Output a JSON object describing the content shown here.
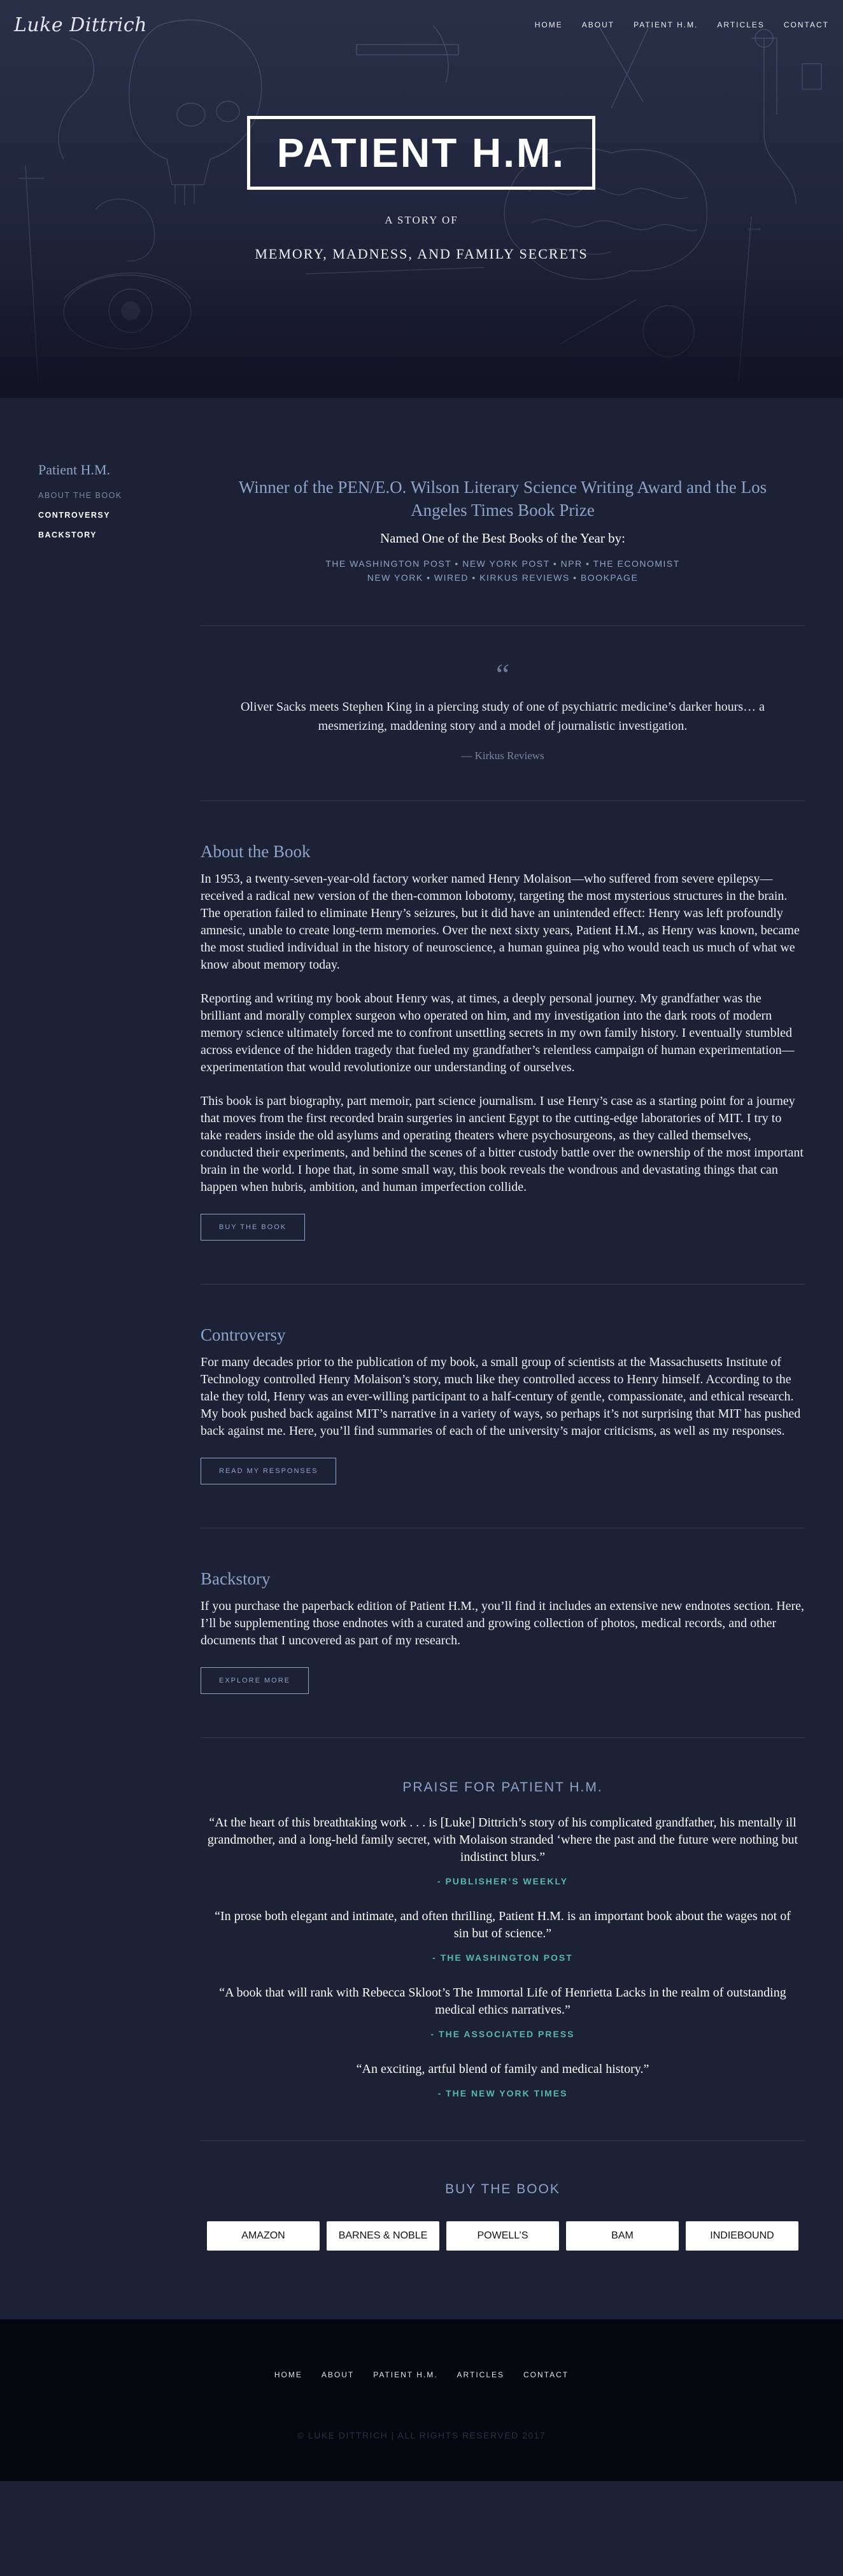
{
  "site": {
    "logo": "Luke Dittrich"
  },
  "nav": [
    "HOME",
    "ABOUT",
    "PATIENT H.M.",
    "ARTICLES",
    "CONTACT"
  ],
  "hero": {
    "title": "PATIENT H.M.",
    "subtitle1": "A STORY OF",
    "subtitle2": "MEMORY, MADNESS, AND FAMILY SECRETS"
  },
  "sidebar": {
    "title": "Patient H.M.",
    "items": [
      "ABOUT THE BOOK",
      "CONTROVERSY",
      "BACKSTORY"
    ]
  },
  "intro": {
    "award": "Winner of the PEN/E.O. Wilson Literary Science Writing Award and the Los Angeles Times Book Prize",
    "named": "Named One of the Best Books of the Year by:",
    "pubs_line1": "THE WASHINGTON POST • NEW YORK POST • NPR • THE ECONOMIST",
    "pubs_line2": "NEW YORK • WIRED • KIRKUS REVIEWS • BOOKPAGE"
  },
  "quote": {
    "mark": "“",
    "text": "Oliver Sacks meets Stephen King in a piercing study of one of psychiatric medicine’s darker hours… a mesmerizing, maddening story and a model of journalistic investigation.",
    "source": "— Kirkus Reviews"
  },
  "about": {
    "heading": "About the Book",
    "p1": "In 1953, a twenty-seven-year-old factory worker named Henry Molaison—who suffered from severe epilepsy—received a radical new version of the then-common lobotomy, targeting the most mysterious structures in the brain. The operation failed to eliminate Henry’s seizures, but it did have an unintended effect: Henry was left profoundly amnesic, unable to create long-term memories. Over the next sixty years, Patient H.M., as Henry was known, became the most studied individual in the history of neuroscience, a human guinea pig who would teach us much of what we know about memory today.",
    "p2": "Reporting and writing my book about Henry was, at times, a deeply personal journey. My grandfather was the brilliant and morally complex surgeon who operated on him, and my investigation into the dark roots of modern memory science ultimately forced me to confront unsettling secrets in my own family history. I eventually stumbled across evidence of the hidden tragedy that fueled my grandfather’s relentless campaign of human experimentation—experimentation that would revolutionize our understanding of ourselves.",
    "p3": "This book is part biography, part memoir, part science journalism. I use Henry’s case as a starting point for a journey that moves from the first recorded brain surgeries in ancient Egypt to the cutting-edge laboratories of MIT. I try to take readers inside the old asylums and operating theaters where psychosurgeons, as they called themselves, conducted their experiments, and behind the scenes of a bitter custody battle over the ownership of the most important brain in the world. I hope that, in some small way, this book reveals the wondrous and devastating things that can happen when hubris, ambition, and human imperfection collide.",
    "button": "BUY THE BOOK"
  },
  "controversy": {
    "heading": "Controversy",
    "p1": "For many decades prior to the publication of my book, a small group of scientists at the Massachusetts Institute of Technology controlled Henry Molaison’s story, much like they controlled access to Henry himself. According to the tale they told, Henry was an ever-willing participant to a half-century of gentle, compassionate, and ethical research. My book pushed back against MIT’s narrative in a variety of ways, so perhaps it’s not surprising that MIT has pushed back against me. Here, you’ll find summaries of each of the university’s major criticisms, as well as my responses.",
    "button": "READ MY RESPONSES"
  },
  "backstory": {
    "heading": "Backstory",
    "p1": "If you purchase the paperback edition of Patient H.M., you’ll find it includes an extensive new endnotes section. Here, I’ll be supplementing those endnotes with a curated and growing collection of photos, medical records, and other documents that I uncovered as part of my research.",
    "button": "EXPLORE MORE"
  },
  "praise": {
    "heading": "PRAISE FOR PATIENT H.M.",
    "items": [
      {
        "text": "“At the heart of this breathtaking work . . . is [Luke] Dittrich’s story of his complicated grandfather, his mentally ill grandmother, and a long-held family secret, with Molaison stranded ‘where the past and the future were nothing but indistinct blurs.”",
        "source": "- PUBLISHER’S WEEKLY"
      },
      {
        "text": "“In prose both elegant and intimate, and often thrilling, Patient H.M. is an important book about the wages not of sin but of science.”",
        "source": "- THE WASHINGTON POST"
      },
      {
        "text": "“A book that will rank with Rebecca Skloot’s The Immortal Life of Henrietta Lacks in the realm of outstanding medical ethics narratives.”",
        "source": "- THE ASSOCIATED PRESS"
      },
      {
        "text": "“An exciting, artful blend of family and medical history.”",
        "source": "- THE NEW YORK TIMES"
      }
    ]
  },
  "buy": {
    "heading": "BUY THE BOOK",
    "stores": [
      "AMAZON",
      "BARNES & NOBLE",
      "POWELL’S",
      "BAM",
      "INDIEBOUND"
    ]
  },
  "footer": {
    "nav": [
      "HOME",
      "ABOUT",
      "PATIENT H.M.",
      "ARTICLES",
      "CONTACT"
    ],
    "copyright": "© LUKE DITTRICH | ALL RIGHTS RESERVED 2017"
  }
}
